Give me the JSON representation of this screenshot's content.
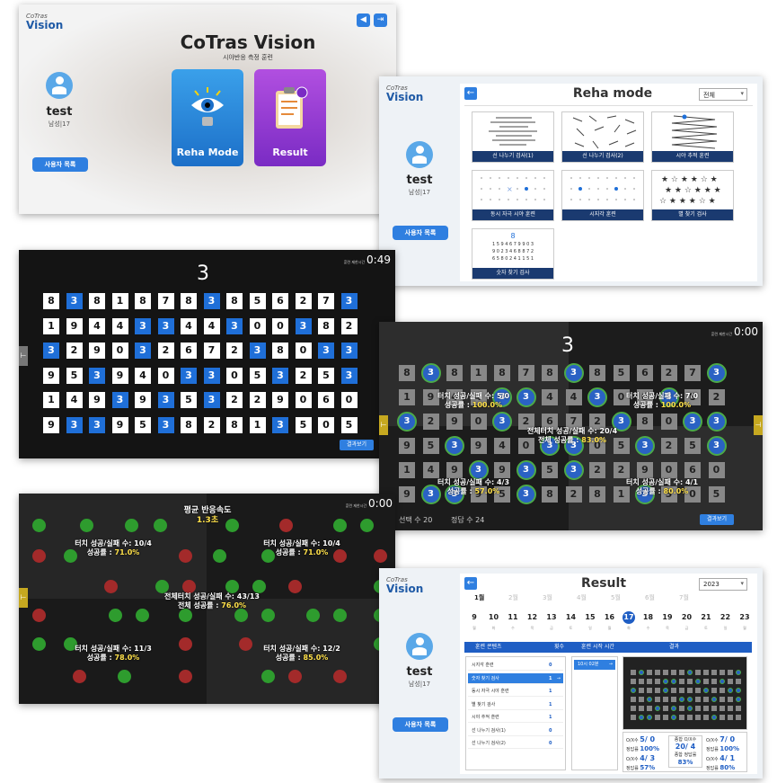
{
  "brand": {
    "top": "CoTras",
    "name": "Vision"
  },
  "user": {
    "name": "test",
    "sub": "남성|17",
    "list_button": "사용자 목록"
  },
  "home": {
    "title": "CoTras Vision",
    "subtitle": "시야반응 측정 훈련",
    "reha_label": "Reha Mode",
    "result_label": "Result"
  },
  "reha": {
    "title": "Reha mode",
    "filter": "전체",
    "tiles": [
      "선 나누기 검사(1)",
      "선 나누기 검사(2)",
      "시야 추적 훈련",
      "동시 자극 시야 훈련",
      "시지각 훈련",
      "별 찾기 검사",
      "숫자 찾기 검사"
    ],
    "digits_target": "8",
    "digit_rows": [
      "1 5 9 4 6 7 9 9 0 3",
      "9 0 2 3 4 6 8 8 7 2",
      "6 5 8 0 2 4 1 1 5 1"
    ]
  },
  "game": {
    "target": "3",
    "timer_label": "훈련 제한시간",
    "timer": "0:49",
    "result_button": "결과보기",
    "grid": [
      [
        "8",
        "3",
        "8",
        "1",
        "8",
        "7",
        "8",
        "3",
        "8",
        "5",
        "6",
        "2",
        "7",
        "3"
      ],
      [
        "1",
        "9",
        "4",
        "4",
        "3",
        "3",
        "4",
        "4",
        "3",
        "0",
        "0",
        "3",
        "8",
        "2"
      ],
      [
        "3",
        "2",
        "9",
        "0",
        "3",
        "2",
        "6",
        "7",
        "2",
        "3",
        "8",
        "0",
        "3",
        "3"
      ],
      [
        "9",
        "5",
        "3",
        "9",
        "4",
        "0",
        "3",
        "3",
        "0",
        "5",
        "3",
        "2",
        "5",
        "3"
      ],
      [
        "1",
        "4",
        "9",
        "3",
        "9",
        "3",
        "5",
        "3",
        "2",
        "2",
        "9",
        "0",
        "6",
        "0"
      ],
      [
        "9",
        "3",
        "3",
        "9",
        "5",
        "3",
        "8",
        "2",
        "8",
        "1",
        "3",
        "5",
        "0",
        "5"
      ]
    ]
  },
  "review": {
    "target": "3",
    "timer": "0:00",
    "result_button": "결과보기",
    "selected": "선택 수 20",
    "correct": "정답 수 24",
    "stats": [
      {
        "a": "터치 성공/실패 수: 5/0",
        "b": "성공률 : ",
        "c": "100.0%"
      },
      {
        "a": "터치 성공/실패 수: 7/0",
        "b": "성공률 : ",
        "c": "100.0%"
      },
      {
        "a": "전체터치 성공/실패 수: 20/4",
        "b": "전체 성공률 : ",
        "c": "83.0%"
      },
      {
        "a": "터치 성공/실패 수: 4/3",
        "b": "성공률 : ",
        "c": "57.0%"
      },
      {
        "a": "터치 성공/실패 수: 4/1",
        "b": "성공률 : ",
        "c": "80.0%"
      }
    ]
  },
  "dots": {
    "timer": "0:00",
    "speed_label": "평균 반응속도",
    "speed": "1.3초",
    "stats": [
      {
        "a": "터치 성공/실패 수: 10/4",
        "b": "성공률 : ",
        "c": "71.0%"
      },
      {
        "a": "터치 성공/실패 수: 10/4",
        "b": "성공률 : ",
        "c": "71.0%"
      },
      {
        "a": "전체터치 성공/실패 수: 43/13",
        "b": "전체 성공률 : ",
        "c": "76.0%"
      },
      {
        "a": "터치 성공/실패 수: 11/3",
        "b": "성공률 : ",
        "c": "78.0%"
      },
      {
        "a": "터치 성공/실패 수: 12/2",
        "b": "성공률 : ",
        "c": "85.0%"
      }
    ]
  },
  "result": {
    "title": "Result",
    "year": "2023",
    "months": [
      "1월",
      "2월",
      "3월",
      "4월",
      "5월",
      "6월",
      "7월"
    ],
    "days": [
      "9",
      "10",
      "11",
      "12",
      "13",
      "14",
      "15",
      "16",
      "17",
      "18",
      "19",
      "20",
      "21",
      "22",
      "23"
    ],
    "weekdays": [
      "월",
      "화",
      "수",
      "목",
      "금",
      "토",
      "일",
      "월",
      "화",
      "수",
      "목",
      "금",
      "토",
      "일",
      "월"
    ],
    "headers": [
      "훈련 콘텐츠",
      "횟수",
      "훈련 시작 시간",
      "결과"
    ],
    "rows": [
      {
        "name": "시지각 훈련",
        "count": "0"
      },
      {
        "name": "숫자 찾기 검사",
        "count": "1"
      },
      {
        "name": "동시 자극 시야 훈련",
        "count": "1"
      },
      {
        "name": "별 찾기 검사",
        "count": "1"
      },
      {
        "name": "시야 추적 훈련",
        "count": "1"
      },
      {
        "name": "선 나누기 검사(1)",
        "count": "0"
      },
      {
        "name": "선 나누기 검사(2)",
        "count": "0"
      }
    ],
    "time": "10시 02분",
    "summary": [
      {
        "a": "O/X수",
        "v": "5/ 0",
        "b": "정답률",
        "p": "100%"
      },
      {
        "a": "종합 O/X수",
        "v": "20/ 4",
        "b": "종합 정답률",
        "p": "83%"
      },
      {
        "a": "O/X수",
        "v": "7/ 0",
        "b": "정답률",
        "p": "100%"
      },
      {
        "a": "O/X수",
        "v": "4/ 3",
        "b": "정답률",
        "p": "57%"
      },
      {
        "a": "O/X수",
        "v": "4/ 1",
        "b": "정답률",
        "p": "80%"
      }
    ]
  }
}
